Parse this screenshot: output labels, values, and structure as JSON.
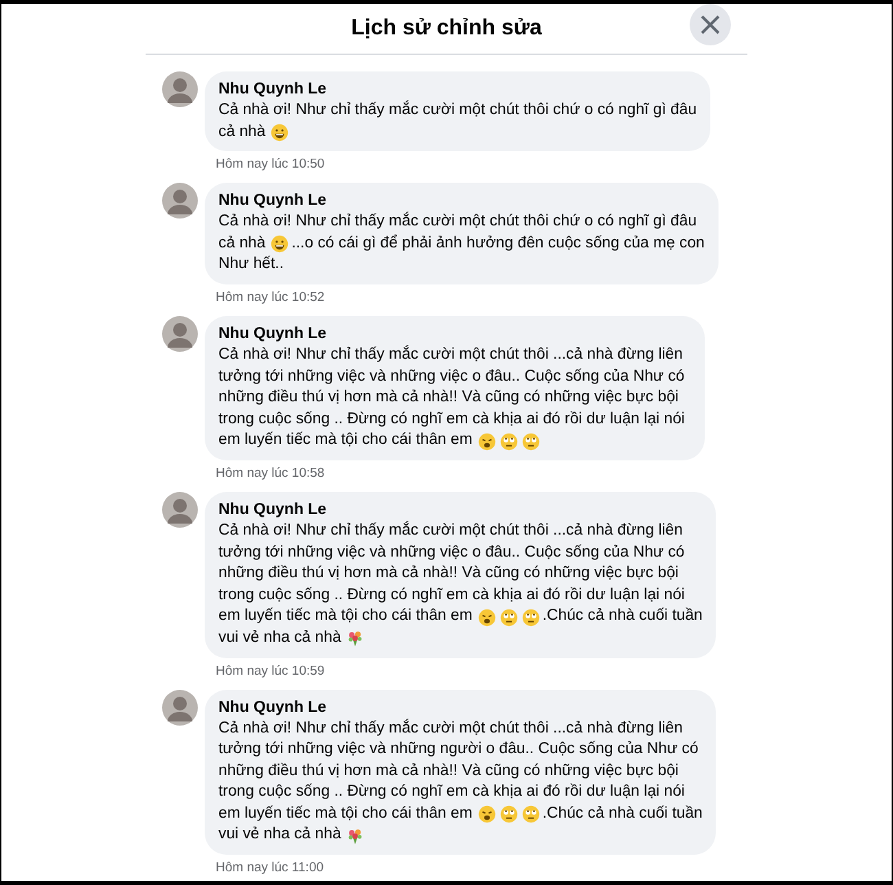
{
  "dialog": {
    "title": "Lịch sử chỉnh sửa"
  },
  "edits": [
    {
      "author": "Nhu Quynh Le",
      "lines": [
        [
          {
            "kind": "text",
            "text": "Cả nhà ơi! Như chỉ thấy mắc cười một chút thôi chứ o có nghĩ gì đâu"
          }
        ],
        [
          {
            "kind": "text",
            "text": "cả nhà"
          },
          {
            "kind": "grin"
          }
        ]
      ],
      "time": "Hôm nay lúc 10:50"
    },
    {
      "author": "Nhu Quynh Le",
      "lines": [
        [
          {
            "kind": "text",
            "text": "Cả nhà ơi! Như chỉ thấy mắc cười một chút thôi chứ o có nghĩ gì đâu"
          }
        ],
        [
          {
            "kind": "text",
            "text": "cả nhà"
          },
          {
            "kind": "grin"
          },
          {
            "kind": "text",
            "text": "...o có cái gì để phải ảnh hưởng đên cuộc sống của mẹ con"
          }
        ],
        [
          {
            "kind": "text",
            "text": "Như hết.."
          }
        ]
      ],
      "time": "Hôm nay lúc 10:52"
    },
    {
      "author": "Nhu Quynh Le",
      "lines": [
        [
          {
            "kind": "text",
            "text": "Cả nhà ơi! Như chỉ thấy mắc cười một chút thôi ...cả nhà đừng liên"
          }
        ],
        [
          {
            "kind": "text",
            "text": "tưởng tới những việc và những việc o đâu.. Cuộc sống của Như có"
          }
        ],
        [
          {
            "kind": "text",
            "text": "những điều thú vị hơn mà cả nhà!! Và cũng có những việc bực bội"
          }
        ],
        [
          {
            "kind": "text",
            "text": "trong cuộc sống .. Đừng có nghĩ em cà khịa ai đó rồi dư luận lại nói"
          }
        ],
        [
          {
            "kind": "text",
            "text": "em luyến tiếc mà tội cho cái thân em"
          },
          {
            "kind": "weary"
          },
          {
            "kind": "eyeroll"
          },
          {
            "kind": "eyeroll"
          }
        ]
      ],
      "time": "Hôm nay lúc 10:58"
    },
    {
      "author": "Nhu Quynh Le",
      "lines": [
        [
          {
            "kind": "text",
            "text": "Cả nhà ơi! Như chỉ thấy mắc cười một chút thôi ...cả nhà đừng liên"
          }
        ],
        [
          {
            "kind": "text",
            "text": "tưởng tới những việc và những việc o đâu.. Cuộc sống của Như có"
          }
        ],
        [
          {
            "kind": "text",
            "text": "những điều thú vị hơn mà cả nhà!! Và cũng có những việc bực bội"
          }
        ],
        [
          {
            "kind": "text",
            "text": "trong cuộc sống .. Đừng có nghĩ em cà khịa ai đó rồi dư luận lại nói"
          }
        ],
        [
          {
            "kind": "text",
            "text": "em luyến tiếc mà tội cho cái thân em"
          },
          {
            "kind": "weary"
          },
          {
            "kind": "eyeroll"
          },
          {
            "kind": "eyeroll"
          },
          {
            "kind": "text",
            "text": ".Chúc cả nhà cuối tuần"
          }
        ],
        [
          {
            "kind": "text",
            "text": "vui vẻ nha cả nhà"
          },
          {
            "kind": "bouquet"
          }
        ]
      ],
      "time": "Hôm nay lúc 10:59"
    },
    {
      "author": "Nhu Quynh Le",
      "lines": [
        [
          {
            "kind": "text",
            "text": "Cả nhà ơi! Như chỉ thấy mắc cười một chút thôi ...cả nhà đừng liên"
          }
        ],
        [
          {
            "kind": "text",
            "text": "tưởng tới những việc và những người o đâu.. Cuộc sống của Như có"
          }
        ],
        [
          {
            "kind": "text",
            "text": "những điều thú vị hơn mà cả nhà!! Và cũng có những việc bực bội"
          }
        ],
        [
          {
            "kind": "text",
            "text": "trong cuộc sống .. Đừng có nghĩ em cà khịa ai đó rồi dư luận lại nói"
          }
        ],
        [
          {
            "kind": "text",
            "text": "em luyến tiếc mà tội cho cái thân em"
          },
          {
            "kind": "weary"
          },
          {
            "kind": "eyeroll"
          },
          {
            "kind": "eyeroll"
          },
          {
            "kind": "text",
            "text": ".Chúc cả nhà cuối tuần"
          }
        ],
        [
          {
            "kind": "text",
            "text": "vui vẻ nha cả nhà"
          },
          {
            "kind": "bouquet"
          }
        ]
      ],
      "time": "Hôm nay lúc 11:00"
    }
  ]
}
